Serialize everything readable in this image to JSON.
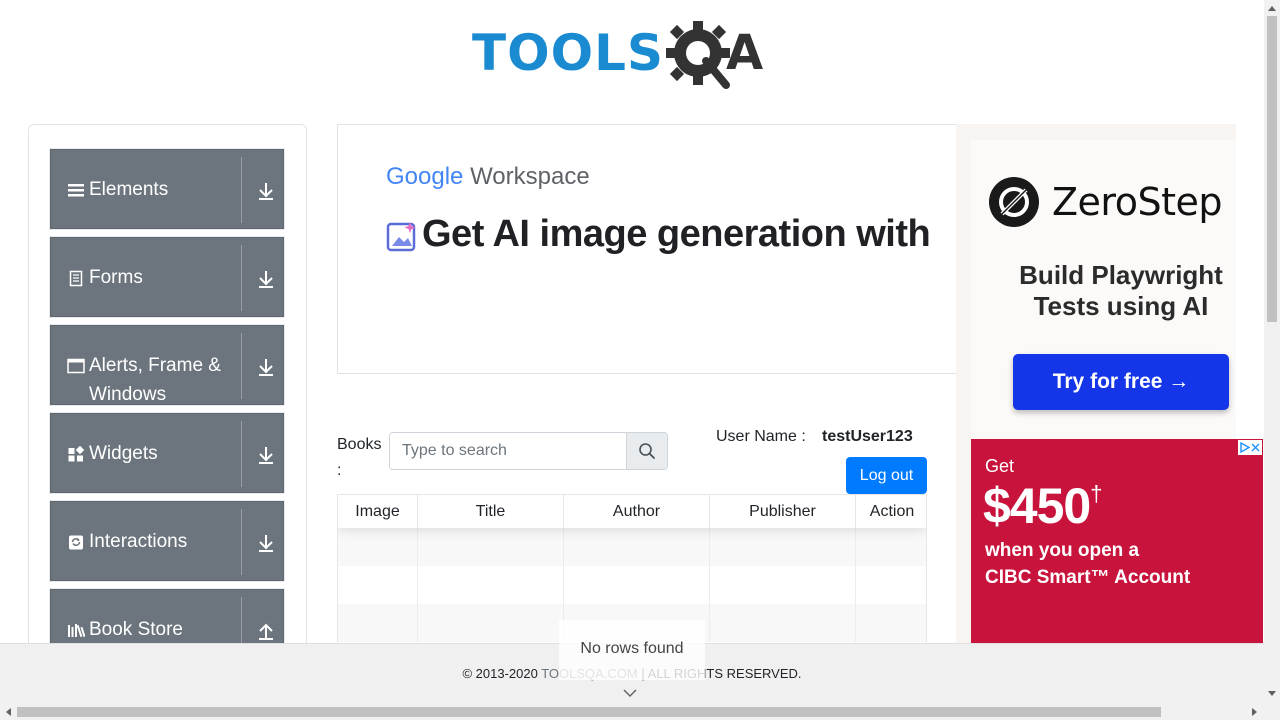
{
  "header": {
    "logo_text": "TOOLSQA",
    "logo_main": "TOOLS",
    "logo_tail": "A",
    "brand_blue": "#1a8ad1",
    "brand_dark": "#333333"
  },
  "sidebar": {
    "groups": [
      {
        "label": "Elements",
        "icon": "hamburger-icon",
        "arrow": "down"
      },
      {
        "label": "Forms",
        "icon": "document-icon",
        "arrow": "down"
      },
      {
        "label": "Alerts, Frame & Windows",
        "icon": "window-icon",
        "arrow": "down"
      },
      {
        "label": "Widgets",
        "icon": "widgets-icon",
        "arrow": "down"
      },
      {
        "label": "Interactions",
        "icon": "interactions-icon",
        "arrow": "down"
      },
      {
        "label": "Book Store",
        "icon": "library-icon",
        "arrow": "up"
      }
    ],
    "group_color": "#6c757d"
  },
  "banner_ad": {
    "brand_google": "Google",
    "brand_workspace": "Workspace",
    "headline": "Get AI image generation with"
  },
  "books": {
    "label": "Books :",
    "search_placeholder": "Type to search",
    "search_icon": "search-icon"
  },
  "user": {
    "label": "User Name :",
    "value": "testUser123",
    "logout_label": "Log out",
    "accent": "#007bff"
  },
  "table": {
    "columns": [
      "Image",
      "Title",
      "Author",
      "Publisher",
      "Action"
    ],
    "empty_text": "No rows found"
  },
  "right_ad": {
    "brand": "ZeroStep",
    "subtitle_line1": "Build Playwright",
    "subtitle_line2": "Tests using AI",
    "cta": "Try for free →",
    "cta_color": "#1436e8"
  },
  "cibc_ad": {
    "get": "Get",
    "amount": "$450",
    "dagger": "†",
    "line1": "when you open a",
    "line2": "CIBC Smart™ Account",
    "bg": "#c8143c"
  },
  "footer": {
    "prefix": "© 2013-2020 ",
    "link": "TOOLSQA.COM",
    "suffix": " | ALL RIGHTS RESERVED."
  }
}
